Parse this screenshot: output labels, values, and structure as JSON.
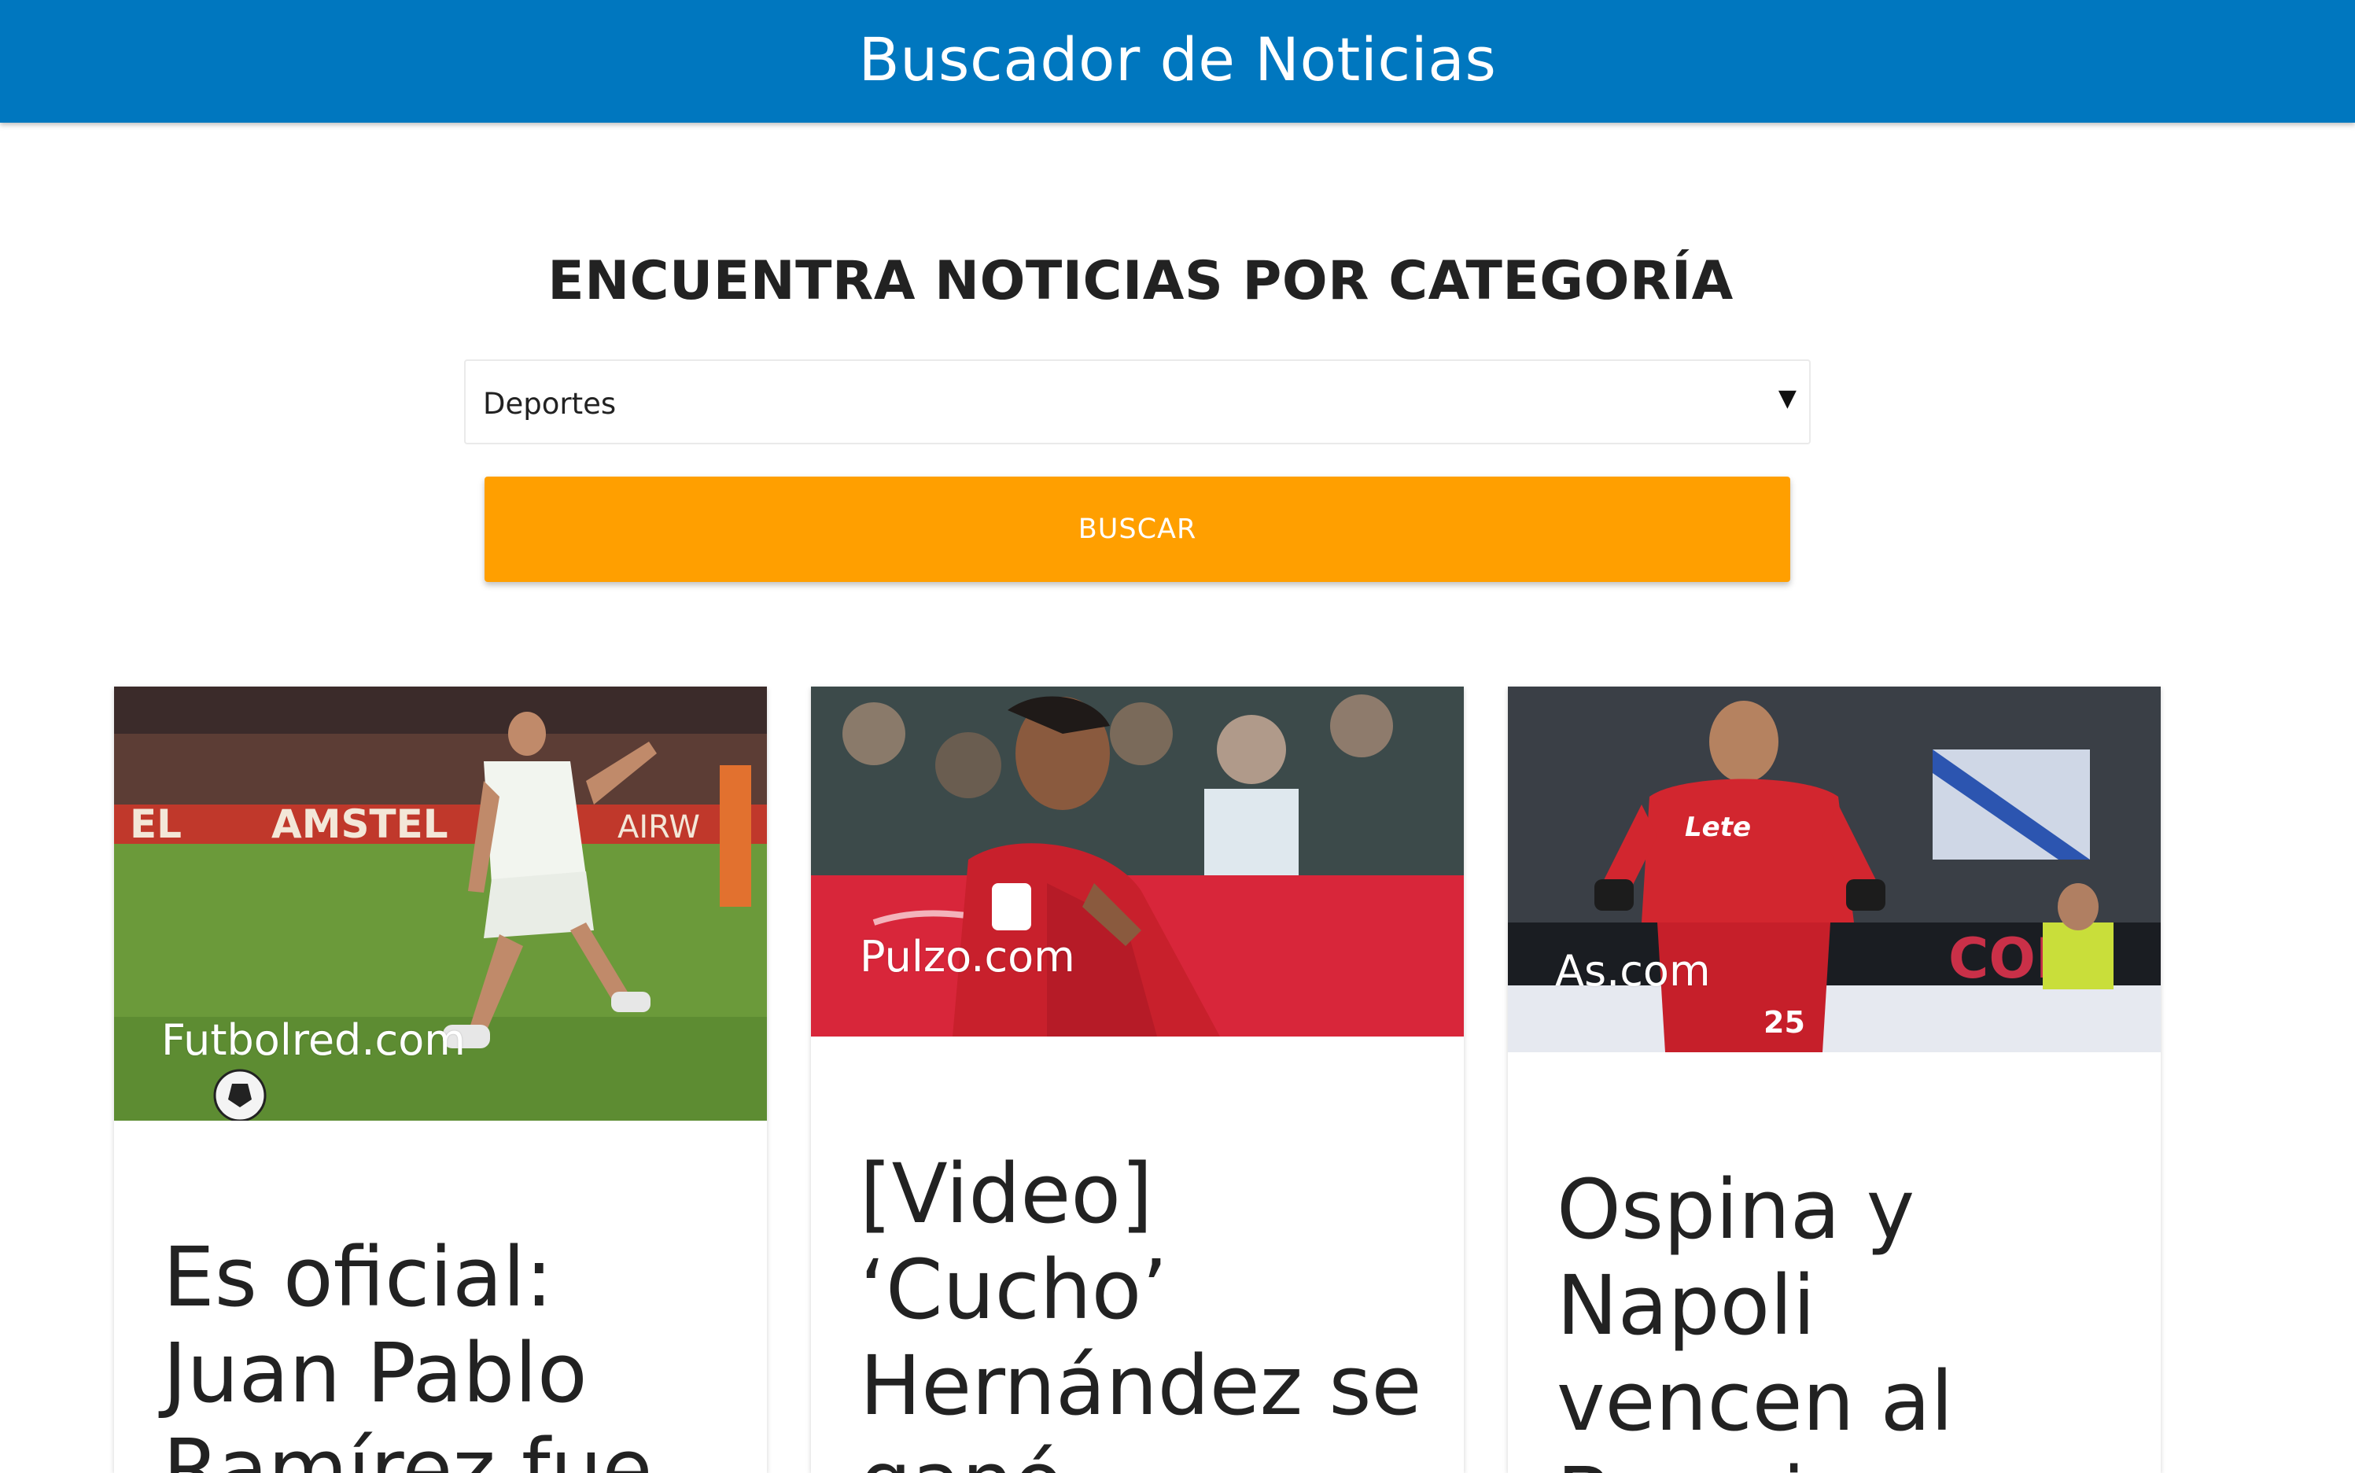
{
  "header": {
    "brand": "Buscador de Noticias"
  },
  "main": {
    "heading": "ENCUENTRA NOTICIAS POR CATEGORÍA",
    "category_select": {
      "value": "Deportes"
    },
    "search_button": "BUSCAR"
  },
  "news": [
    {
      "source": "Futbolred.com",
      "title": "Es oficial: Juan Pablo Ramírez fue"
    },
    {
      "source": "Pulzo.com",
      "title": "[Video] ‘Cucho’ Hernández se ganó"
    },
    {
      "source": "As.com",
      "title": "Ospina y Napoli vencen al Brescia"
    }
  ],
  "colors": {
    "navbar": "#0077bf",
    "button": "#ff9f00"
  }
}
